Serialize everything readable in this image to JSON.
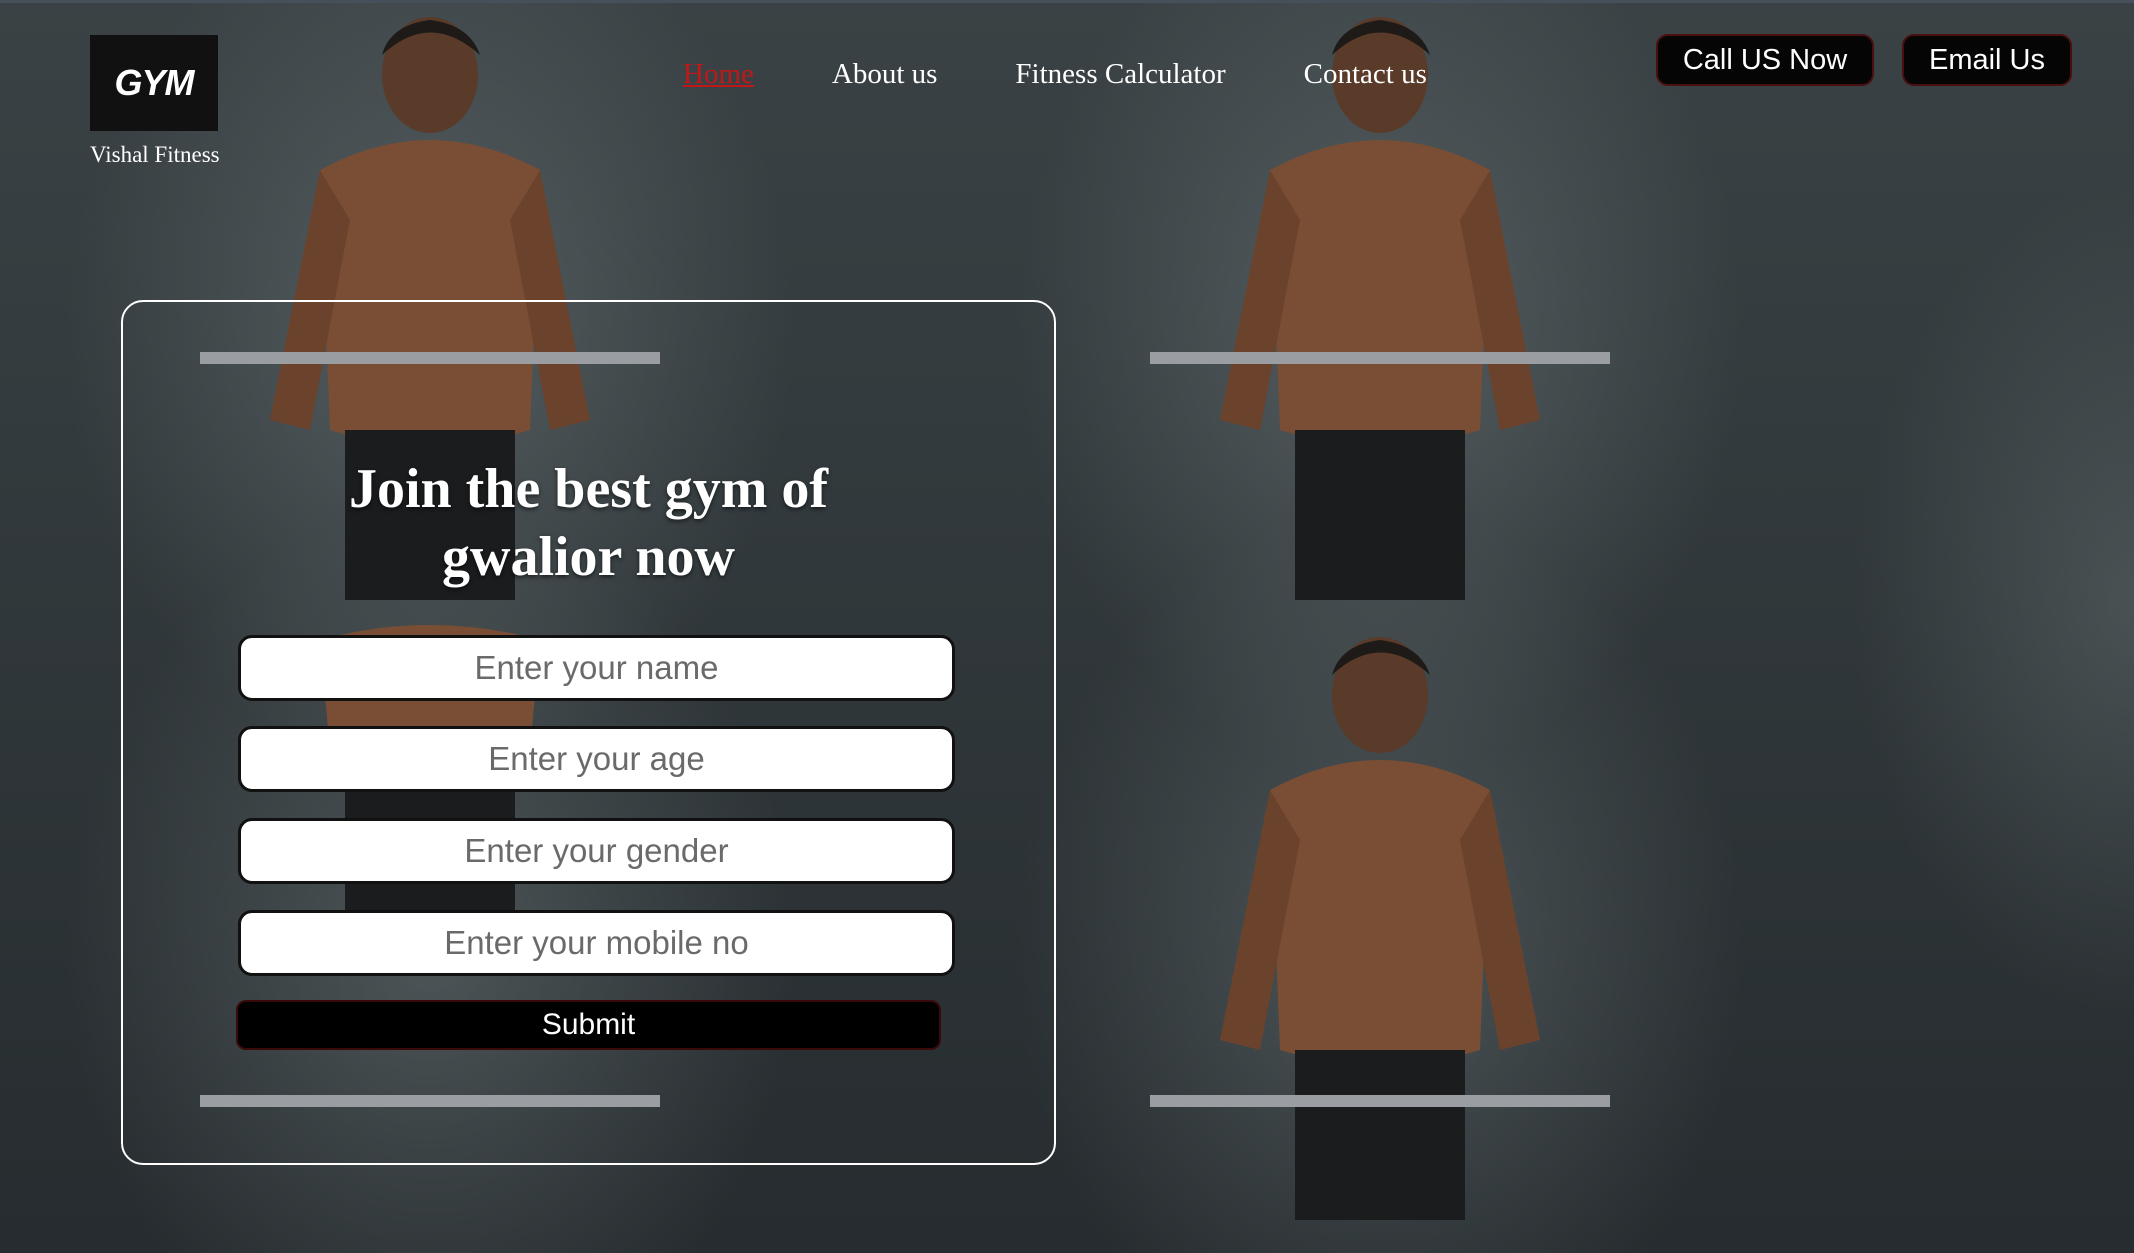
{
  "brand": {
    "logo_text": "GYM",
    "name": "Vishal Fitness"
  },
  "nav": {
    "items": [
      {
        "label": "Home",
        "active": true
      },
      {
        "label": "About us",
        "active": false
      },
      {
        "label": "Fitness Calculator",
        "active": false
      },
      {
        "label": "Contact us",
        "active": false
      }
    ]
  },
  "header_actions": {
    "call_label": "Call US Now",
    "email_label": "Email Us"
  },
  "hero": {
    "headline_line1": "Join the best gym of",
    "headline_line2": "gwalior now"
  },
  "form": {
    "name_placeholder": "Enter your name",
    "age_placeholder": "Enter your age",
    "gender_placeholder": "Enter your gender",
    "mobile_placeholder": "Enter your mobile no",
    "submit_label": "Submit"
  },
  "colors": {
    "active_nav": "#c01818",
    "button_bg": "#050505",
    "card_border": "#ffffff"
  },
  "icons": [
    "gym-logo"
  ]
}
